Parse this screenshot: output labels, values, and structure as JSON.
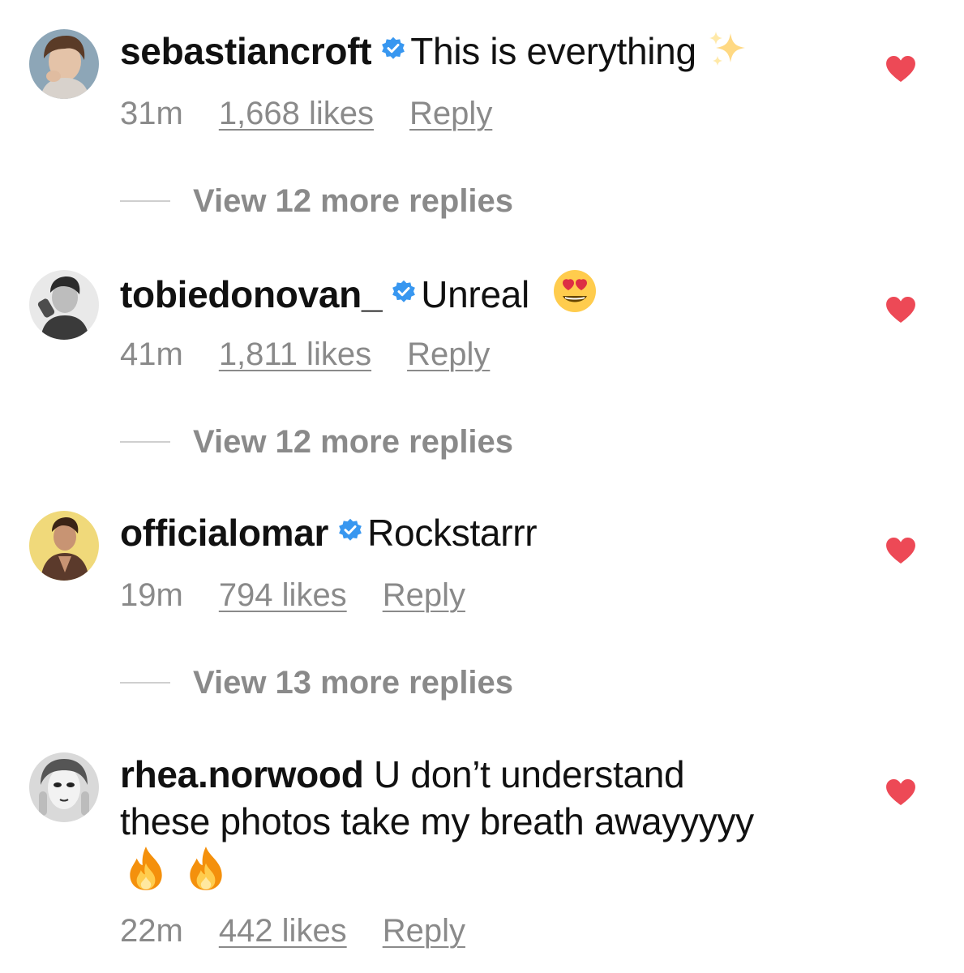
{
  "comments": [
    {
      "username": "sebastiancroft",
      "text": "This is everything",
      "emoji": "sparkles",
      "time": "31m",
      "likes": "1,668 likes",
      "reply": "Reply",
      "view_replies": "View 12 more replies"
    },
    {
      "username": "tobiedonovan_",
      "text": "Unreal",
      "emoji": "heart-eyes",
      "time": "41m",
      "likes": "1,811 likes",
      "reply": "Reply",
      "view_replies": "View 12 more replies"
    },
    {
      "username": "officialomar",
      "text": "Rockstarrr",
      "time": "19m",
      "likes": "794 likes",
      "reply": "Reply",
      "view_replies": "View 13 more replies"
    },
    {
      "username": "rhea.norwood",
      "text_line1": "U don’t understand",
      "text_line2": "these photos take my breath awayyyyy",
      "emoji": "fire x2",
      "time": "22m",
      "likes": "442 likes",
      "reply": "Reply"
    }
  ],
  "colors": {
    "verified_badge": "#3897f0",
    "heart": "#ed4956",
    "meta_text": "#8a8a8a"
  },
  "icons": [
    "verified-badge-icon",
    "heart-icon",
    "sparkles-emoji",
    "heart-eyes-emoji",
    "fire-emoji"
  ]
}
